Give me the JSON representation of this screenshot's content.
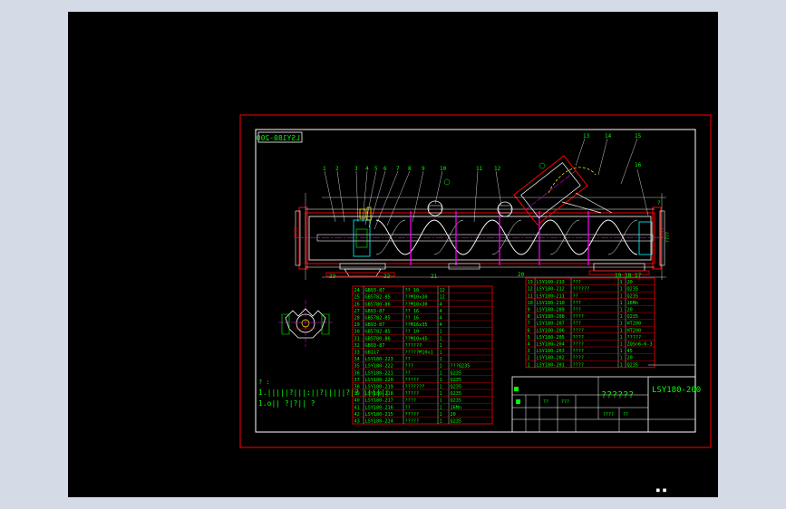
{
  "drawing": {
    "drawing_number": "LSY180-200",
    "drawing_number_mirrored": "LSY180-200",
    "note_heading": "? :",
    "note_line1": "1.|||||?|||:||?|||||?|? ||||||",
    "note_line2": "1.o|| ?|?|| ?",
    "status_mark": "■ ■"
  },
  "callouts": {
    "top": [
      "1",
      "2",
      "3",
      "4",
      "5",
      "6",
      "7",
      "8",
      "9",
      "10",
      "11",
      "12",
      "13",
      "14",
      "15",
      "16",
      "?"
    ],
    "bottom": [
      "23",
      "22",
      "21",
      "20",
      "19",
      "18",
      "17"
    ]
  },
  "bom_left": [
    {
      "no": "24",
      "code": "GB93-87",
      "name": "?? 10",
      "qty": "12",
      "mat": ""
    },
    {
      "no": "25",
      "code": "GB5782-85",
      "name": "??M10x30",
      "qty": "12",
      "mat": ""
    },
    {
      "no": "26",
      "code": "GB5780-86",
      "name": "??M10x30",
      "qty": "4",
      "mat": ""
    },
    {
      "no": "27",
      "code": "GB93-87",
      "name": "?? 16",
      "qty": "4",
      "mat": ""
    },
    {
      "no": "28",
      "code": "GB5782-85",
      "name": "?? 16",
      "qty": "4",
      "mat": ""
    },
    {
      "no": "29",
      "code": "GB93-87",
      "name": "??M16x35",
      "qty": "4",
      "mat": ""
    },
    {
      "no": "30",
      "code": "GB5782-85",
      "name": "?? 10",
      "qty": "1",
      "mat": ""
    },
    {
      "no": "31",
      "code": "GB5780-86",
      "name": "??M10x45",
      "qty": "1",
      "mat": ""
    },
    {
      "no": "32",
      "code": "GB93-87",
      "name": "??????",
      "qty": "1",
      "mat": ""
    },
    {
      "no": "33",
      "code": "GB117",
      "name": "?????M10x1",
      "qty": "1",
      "mat": ""
    },
    {
      "no": "34",
      "code": "LSY180-223",
      "name": "??",
      "qty": "1",
      "mat": ""
    },
    {
      "no": "35",
      "code": "LSY180-222",
      "name": "???",
      "qty": "1",
      "mat": "???Q235"
    },
    {
      "no": "36",
      "code": "LSY180-221",
      "name": "??",
      "qty": "1",
      "mat": "Q235"
    },
    {
      "no": "37",
      "code": "LSY180-220",
      "name": "?????",
      "qty": "1",
      "mat": "Q235"
    },
    {
      "no": "38",
      "code": "LSY180-219",
      "name": "???????",
      "qty": "1",
      "mat": "Q235"
    },
    {
      "no": "39",
      "code": "LSY180-218",
      "name": "?????",
      "qty": "1",
      "mat": "Q235"
    },
    {
      "no": "40",
      "code": "LSY180-217",
      "name": "????",
      "qty": "1",
      "mat": "Q235"
    },
    {
      "no": "41",
      "code": "LSY180-216",
      "name": "??",
      "qty": "1",
      "mat": "16Mn"
    },
    {
      "no": "42",
      "code": "LSY180-215",
      "name": "?????",
      "qty": "1",
      "mat": "20"
    },
    {
      "no": "43",
      "code": "LSY180-214",
      "name": "?????",
      "qty": "1",
      "mat": "Q235"
    }
  ],
  "bom_right": [
    {
      "no": "13",
      "code": "LSY180-213",
      "name": "???",
      "qty": "1",
      "mat": "20"
    },
    {
      "no": "12",
      "code": "LSY180-212",
      "name": "??????",
      "qty": "1",
      "mat": "Q235"
    },
    {
      "no": "11",
      "code": "LSY180-211",
      "name": "??",
      "qty": "1",
      "mat": "Q235"
    },
    {
      "no": "10",
      "code": "LSY180-210",
      "name": "???",
      "qty": "1",
      "mat": "16Mn"
    },
    {
      "no": "9",
      "code": "LSY180-209",
      "name": "???",
      "qty": "1",
      "mat": "20"
    },
    {
      "no": "8",
      "code": "LSY180-208",
      "name": "????",
      "qty": "1",
      "mat": "Q235"
    },
    {
      "no": "7",
      "code": "LSY180-207",
      "name": "???",
      "qty": "1",
      "mat": "HT200"
    },
    {
      "no": "6",
      "code": "LSY180-206",
      "name": "????",
      "qty": "1",
      "mat": "HT200"
    },
    {
      "no": "5",
      "code": "LSY180-205",
      "name": "????",
      "qty": "1",
      "mat": "?????"
    },
    {
      "no": "4",
      "code": "LSY180-204",
      "name": "????",
      "qty": "1",
      "mat": "ZQSn6-6-3"
    },
    {
      "no": "3",
      "code": "LSY180-203",
      "name": "????",
      "qty": "1",
      "mat": "45"
    },
    {
      "no": "2",
      "code": "LSY180-202",
      "name": "????",
      "qty": "1",
      "mat": "20"
    },
    {
      "no": "1",
      "code": "LSY180-201",
      "name": "????",
      "qty": "1",
      "mat": "Q235"
    }
  ],
  "title_block": {
    "title": "??????",
    "number": "LSY180-200",
    "q1": "??",
    "q2": "????",
    "q3": "???",
    "q4": "??"
  },
  "colors": {
    "background": "#000000",
    "desktop": "#d4dbe6",
    "frame": "#ff0000",
    "line": "#ffffff",
    "text": "#00ff00",
    "accent": "#ffff00",
    "center": "#ff00ff",
    "hidden": "#00ffff"
  }
}
